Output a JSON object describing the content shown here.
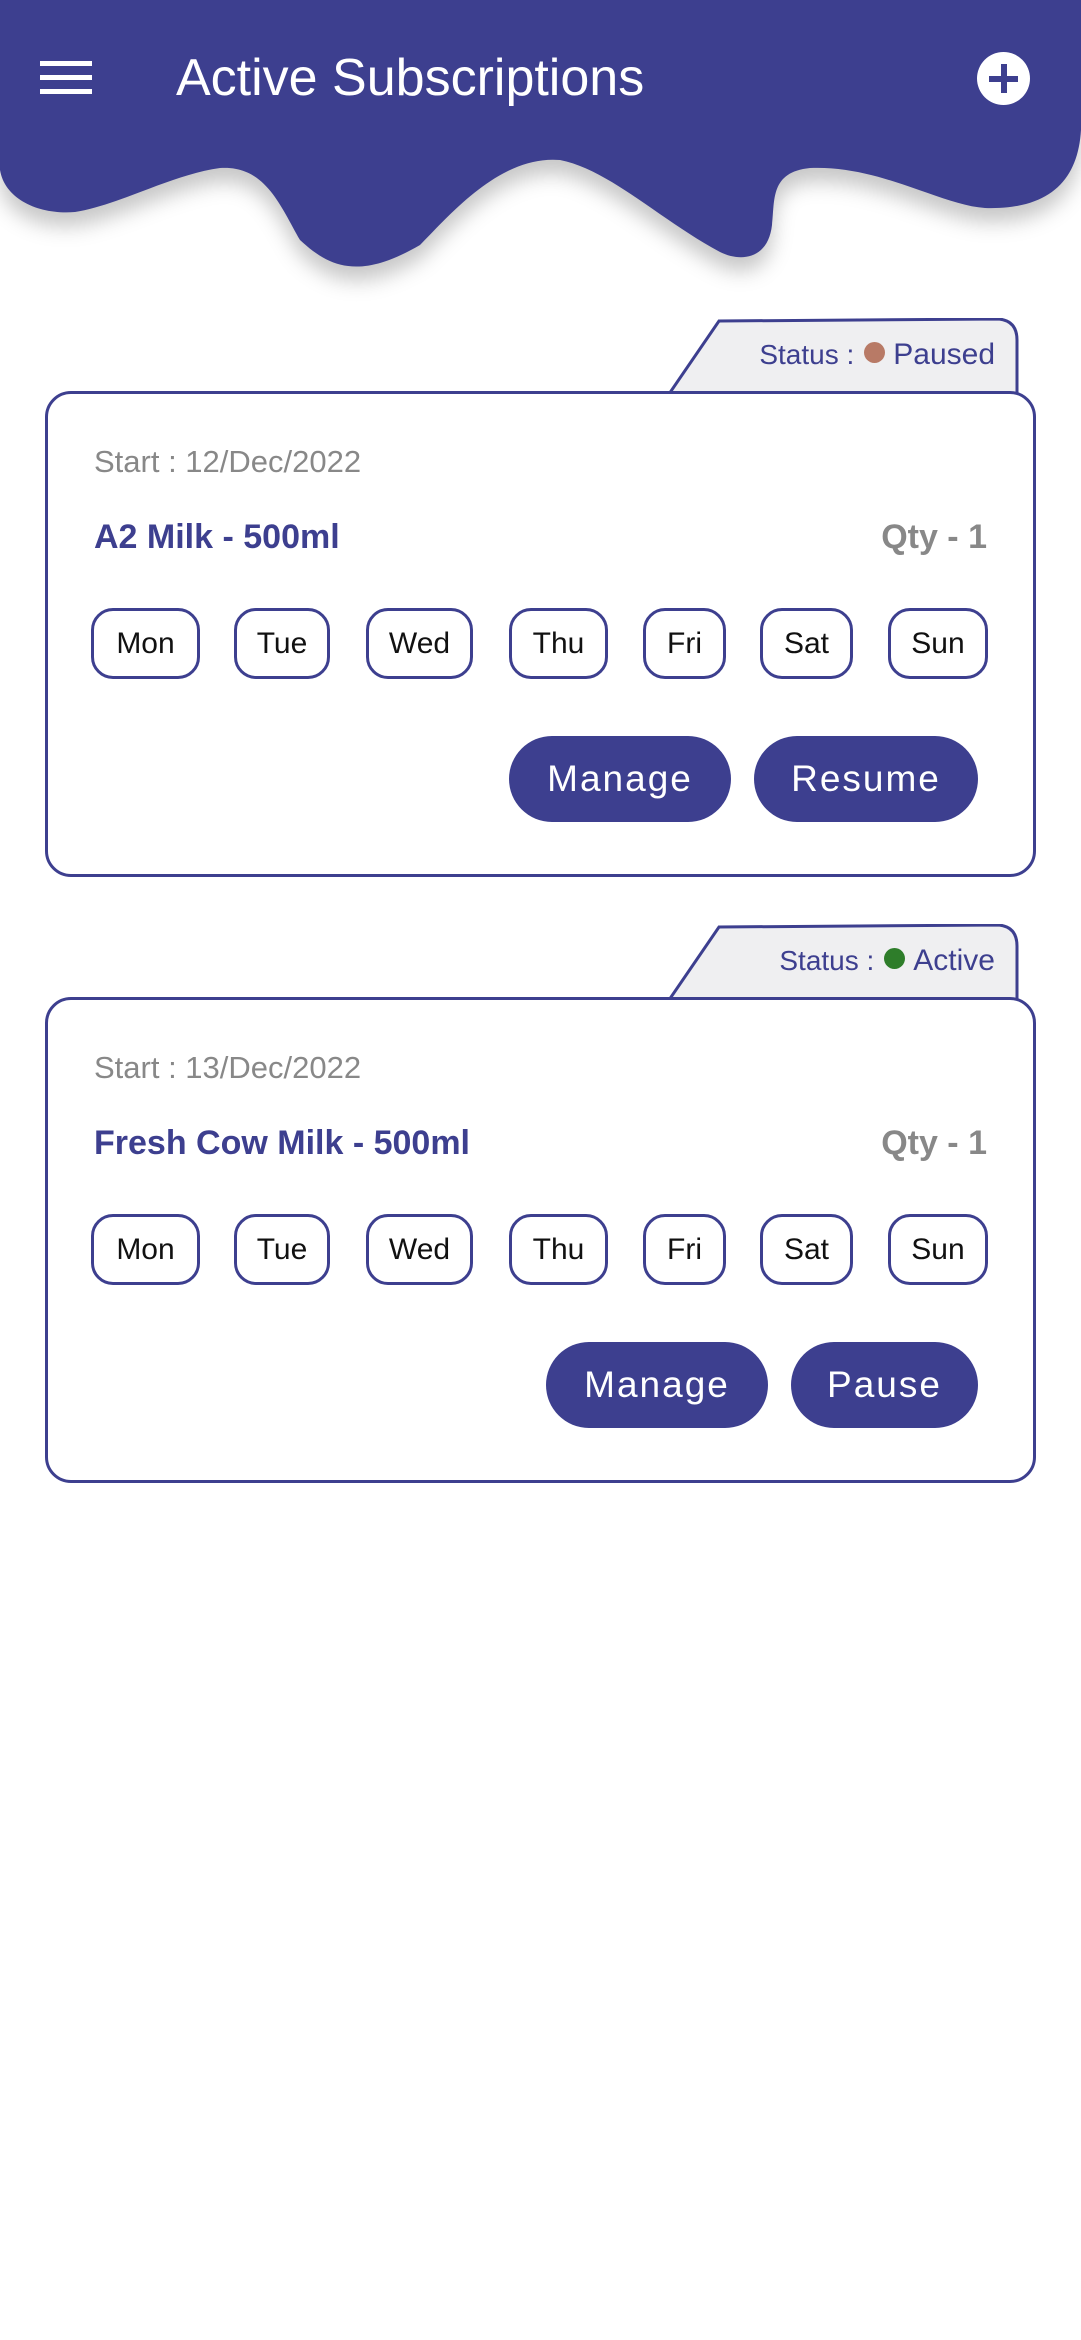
{
  "header": {
    "title": "Active Subscriptions",
    "menu_icon": "hamburger-icon",
    "add_icon": "plus-circle-icon"
  },
  "colors": {
    "brand": "#3d3f8f",
    "paused": "#b87a66",
    "active": "#2e7d2a",
    "muted": "#888888"
  },
  "subscriptions": [
    {
      "status_label": "Status :",
      "status": "Paused",
      "start": "Start : 12/Dec/2022",
      "product": "A2 Milk - 500ml",
      "qty": "Qty - 1",
      "days": [
        "Mon",
        "Tue",
        "Wed",
        "Thu",
        "Fri",
        "Sat",
        "Sun"
      ],
      "manage_label": "Manage",
      "action_label": "Resume"
    },
    {
      "status_label": "Status :",
      "status": "Active",
      "start": "Start : 13/Dec/2022",
      "product": "Fresh Cow Milk - 500ml",
      "qty": "Qty - 1",
      "days": [
        "Mon",
        "Tue",
        "Wed",
        "Thu",
        "Fri",
        "Sat",
        "Sun"
      ],
      "manage_label": "Manage",
      "action_label": "Pause"
    }
  ]
}
